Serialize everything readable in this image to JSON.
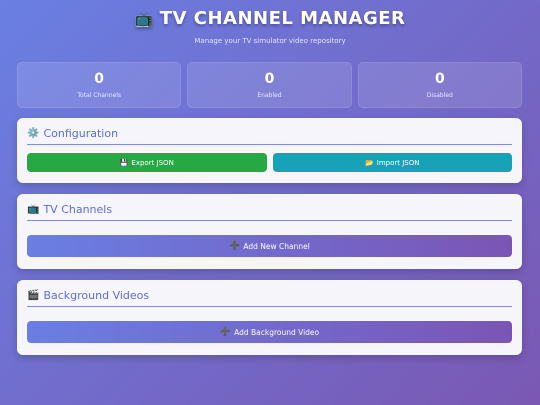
{
  "header": {
    "icon": "tv-icon",
    "title": "TV CHANNEL MANAGER",
    "subtitle": "Manage your TV simulator video repository"
  },
  "stats": [
    {
      "value": "0",
      "label": "Total Channels"
    },
    {
      "value": "0",
      "label": "Enabled"
    },
    {
      "value": "0",
      "label": "Disabled"
    }
  ],
  "configuration": {
    "icon": "gear-icon",
    "title": "Configuration",
    "export_label": "Export JSON",
    "export_icon": "floppy-disk-icon",
    "import_label": "Import JSON",
    "import_icon": "folder-icon"
  },
  "channels": {
    "icon": "tv-icon",
    "title": "TV Channels",
    "add_label": "Add New Channel",
    "add_icon": "plus-icon"
  },
  "background": {
    "icon": "clapperboard-icon",
    "title": "Background Videos",
    "add_label": "Add Background Video",
    "add_icon": "plus-icon"
  },
  "colors": {
    "accent": "#5b6ed6",
    "export": "#28a745",
    "import": "#17a2b8"
  }
}
